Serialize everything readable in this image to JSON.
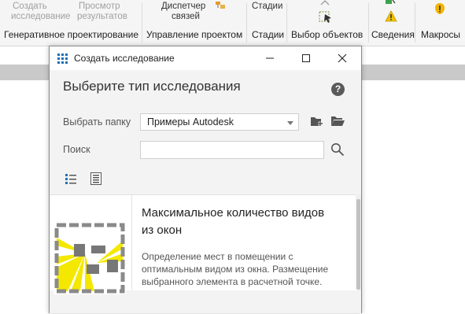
{
  "ribbon": {
    "items": [
      {
        "line1": "Создать",
        "line2": "исследование",
        "disabled": true
      },
      {
        "line1": "Просмотр",
        "line2": "результатов",
        "disabled": true
      },
      {
        "line1": "Диспетчер",
        "line2": "связей",
        "disabled": false
      },
      {
        "line1": "Стадии",
        "disabled": false
      }
    ],
    "groups": [
      "Генеративное проектирование",
      "Управление проектом",
      "Стадии",
      "Выбор объектов",
      "Сведения",
      "Макросы"
    ]
  },
  "dialog": {
    "title": "Создать исследование",
    "heading": "Выберите тип исследования",
    "help_glyph": "?",
    "folder_label": "Выбрать папку",
    "folder_value": "Примеры Autodesk",
    "search_label": "Поиск",
    "search_value": "",
    "study": {
      "title": "Максимальное количество видов из окон",
      "description": "Определение мест в помещении с оптимальным видом из окна. Размещение выбранного элемента в расчетной точке."
    }
  },
  "colors": {
    "accent_blue": "#1f6fb5",
    "thumb_yellow": "#f4e800",
    "ribbon_bg": "#f5f5f5",
    "dialog_body": "#f3f3f3"
  }
}
